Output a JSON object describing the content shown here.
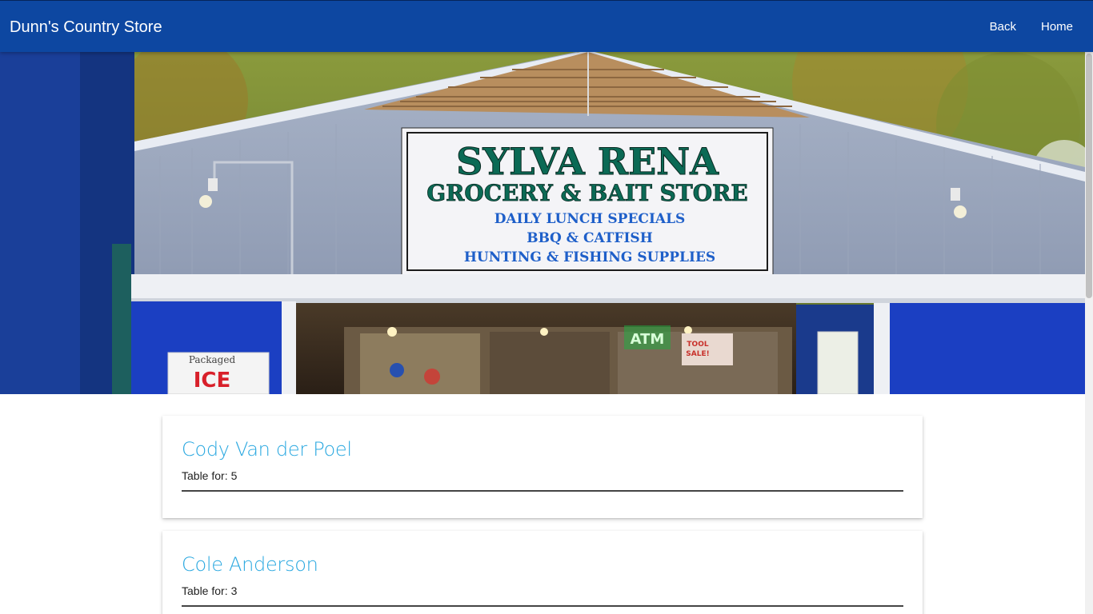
{
  "navbar": {
    "brand": "Dunn's Country Store",
    "links": [
      {
        "label": "Back"
      },
      {
        "label": "Home"
      }
    ],
    "color": "#0d47a1"
  },
  "hero": {
    "sign": {
      "line1": "SYLVA RENA",
      "line2": "GROCERY & BAIT STORE",
      "line3": "DAILY LUNCH SPECIALS",
      "line4": "BBQ & CATFISH",
      "line5": "HUNTING & FISHING SUPPLIES"
    },
    "ice_sign": {
      "top": "Packaged",
      "bottom": "ICE"
    },
    "atm_sign": "ATM",
    "window_sign": {
      "line1": "TOOL",
      "line2": "SALE!"
    }
  },
  "reservations": [
    {
      "name": "Cody Van der Poel",
      "table_label": "Table for:",
      "party_size": "5"
    },
    {
      "name": "Cole Anderson",
      "table_label": "Table for:",
      "party_size": "3"
    }
  ],
  "colors": {
    "accent_name": "#2aa8e0",
    "sign_green": "#0b6a55",
    "sign_blue": "#1e5fc9"
  }
}
